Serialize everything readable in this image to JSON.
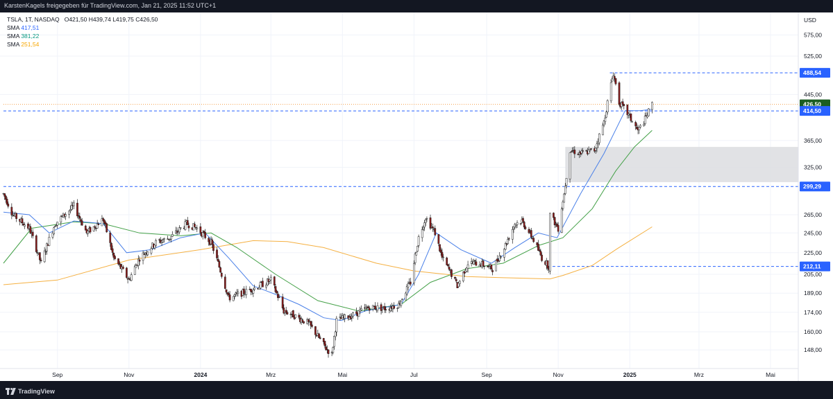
{
  "header": {
    "credit": "KarstenKagels freigegeben für TradingView.com, Jan 21, 2025 11:52 UTC+1"
  },
  "legend": {
    "symbol_line": "TSLA, 1T, NASDAQ",
    "ohlc": "O421,50  H439,74  L419,75  C426,50",
    "ma": [
      {
        "label": "SMA",
        "value": "417,51",
        "color": "#2962ff"
      },
      {
        "label": "SMA",
        "value": "381,22",
        "color": "#43a047"
      },
      {
        "label": "SMA",
        "value": "251,54",
        "color": "#f5b041"
      }
    ]
  },
  "footer": {
    "brand": "TradingView"
  },
  "chart_data": {
    "type": "candlestick",
    "currency_label": "USD",
    "y_scale": "log",
    "ylim": [
      140,
      620
    ],
    "y_ticks": [
      {
        "value": 575,
        "label": "575,00"
      },
      {
        "value": 525,
        "label": "525,00"
      },
      {
        "value": 445,
        "label": "445,00"
      },
      {
        "value": 365,
        "label": "365,00"
      },
      {
        "value": 325,
        "label": "325,00"
      },
      {
        "value": 265,
        "label": "265,00"
      },
      {
        "value": 245,
        "label": "245,00"
      },
      {
        "value": 225,
        "label": "225,00"
      },
      {
        "value": 205,
        "label": "205,00"
      },
      {
        "value": 189,
        "label": "189,00"
      },
      {
        "value": 174,
        "label": "174,00"
      },
      {
        "value": 160,
        "label": "160,00"
      },
      {
        "value": 148,
        "label": "148,00"
      }
    ],
    "x_ticks": [
      {
        "date": "2023-09-01",
        "label": "Sep",
        "bold": false
      },
      {
        "date": "2023-11-01",
        "label": "Nov",
        "bold": false
      },
      {
        "date": "2024-01-01",
        "label": "2024",
        "bold": true
      },
      {
        "date": "2024-03-01",
        "label": "Mrz",
        "bold": false
      },
      {
        "date": "2024-05-01",
        "label": "Mai",
        "bold": false
      },
      {
        "date": "2024-07-01",
        "label": "Jul",
        "bold": false
      },
      {
        "date": "2024-09-01",
        "label": "Sep",
        "bold": false
      },
      {
        "date": "2024-11-01",
        "label": "Nov",
        "bold": false
      },
      {
        "date": "2025-01-01",
        "label": "2025",
        "bold": true
      },
      {
        "date": "2025-03-01",
        "label": "Mrz",
        "bold": false
      },
      {
        "date": "2025-05-01",
        "label": "Mai",
        "bold": false
      }
    ],
    "price_path": [
      [
        "2023-07-17",
        290
      ],
      [
        "2023-07-25",
        265
      ],
      [
        "2023-08-08",
        250
      ],
      [
        "2023-08-18",
        215
      ],
      [
        "2023-08-30",
        255
      ],
      [
        "2023-09-15",
        275
      ],
      [
        "2023-09-26",
        245
      ],
      [
        "2023-10-10",
        260
      ],
      [
        "2023-10-19",
        220
      ],
      [
        "2023-11-01",
        200
      ],
      [
        "2023-11-10",
        220
      ],
      [
        "2023-11-24",
        235
      ],
      [
        "2023-12-06",
        240
      ],
      [
        "2023-12-20",
        255
      ],
      [
        "2023-12-29",
        250
      ],
      [
        "2024-01-10",
        235
      ],
      [
        "2024-01-25",
        185
      ],
      [
        "2024-02-08",
        190
      ],
      [
        "2024-02-20",
        195
      ],
      [
        "2024-03-01",
        200
      ],
      [
        "2024-03-12",
        175
      ],
      [
        "2024-03-20",
        172
      ],
      [
        "2024-04-02",
        166
      ],
      [
        "2024-04-17",
        149
      ],
      [
        "2024-04-22",
        145
      ],
      [
        "2024-04-26",
        168
      ],
      [
        "2024-05-10",
        172
      ],
      [
        "2024-05-24",
        178
      ],
      [
        "2024-06-07",
        177
      ],
      [
        "2024-06-18",
        180
      ],
      [
        "2024-06-28",
        198
      ],
      [
        "2024-07-05",
        240
      ],
      [
        "2024-07-11",
        262
      ],
      [
        "2024-07-19",
        245
      ],
      [
        "2024-07-25",
        220
      ],
      [
        "2024-08-02",
        205
      ],
      [
        "2024-08-07",
        195
      ],
      [
        "2024-08-16",
        215
      ],
      [
        "2024-08-26",
        215
      ],
      [
        "2024-09-06",
        210
      ],
      [
        "2024-09-16",
        230
      ],
      [
        "2024-09-25",
        255
      ],
      [
        "2024-10-01",
        258
      ],
      [
        "2024-10-10",
        240
      ],
      [
        "2024-10-18",
        220
      ],
      [
        "2024-10-24",
        212
      ],
      [
        "2024-10-25",
        265
      ],
      [
        "2024-11-01",
        250
      ],
      [
        "2024-11-06",
        290
      ],
      [
        "2024-11-11",
        350
      ],
      [
        "2024-11-20",
        345
      ],
      [
        "2024-12-02",
        350
      ],
      [
        "2024-12-10",
        395
      ],
      [
        "2024-12-18",
        488
      ],
      [
        "2024-12-23",
        430
      ],
      [
        "2024-12-30",
        410
      ],
      [
        "2025-01-08",
        380
      ],
      [
        "2025-01-14",
        400
      ],
      [
        "2025-01-20",
        426.5
      ]
    ],
    "sma_short_path": [
      [
        "2023-07-17",
        268
      ],
      [
        "2023-08-08",
        265
      ],
      [
        "2023-08-25",
        245
      ],
      [
        "2023-09-15",
        258
      ],
      [
        "2023-10-10",
        255
      ],
      [
        "2023-10-30",
        225
      ],
      [
        "2023-11-20",
        228
      ],
      [
        "2023-12-15",
        240
      ],
      [
        "2024-01-05",
        245
      ],
      [
        "2024-01-25",
        220
      ],
      [
        "2024-02-15",
        195
      ],
      [
        "2024-03-05",
        188
      ],
      [
        "2024-03-25",
        180
      ],
      [
        "2024-04-15",
        170
      ],
      [
        "2024-04-30",
        168
      ],
      [
        "2024-05-20",
        175
      ],
      [
        "2024-06-20",
        180
      ],
      [
        "2024-07-05",
        205
      ],
      [
        "2024-07-20",
        245
      ],
      [
        "2024-08-10",
        228
      ],
      [
        "2024-09-05",
        215
      ],
      [
        "2024-09-25",
        230
      ],
      [
        "2024-10-15",
        245
      ],
      [
        "2024-10-31",
        240
      ],
      [
        "2024-11-20",
        290
      ],
      [
        "2024-12-10",
        345
      ],
      [
        "2024-12-28",
        415
      ],
      [
        "2025-01-10",
        415
      ],
      [
        "2025-01-20",
        417.51
      ]
    ],
    "sma_mid_path": [
      [
        "2023-07-17",
        215
      ],
      [
        "2023-08-10",
        250
      ],
      [
        "2023-09-15",
        257
      ],
      [
        "2023-10-10",
        255
      ],
      [
        "2023-11-10",
        245
      ],
      [
        "2023-12-15",
        242
      ],
      [
        "2024-01-10",
        245
      ],
      [
        "2024-02-01",
        230
      ],
      [
        "2024-03-05",
        205
      ],
      [
        "2024-04-10",
        183
      ],
      [
        "2024-05-15",
        175
      ],
      [
        "2024-06-20",
        180
      ],
      [
        "2024-07-15",
        198
      ],
      [
        "2024-08-15",
        210
      ],
      [
        "2024-09-15",
        215
      ],
      [
        "2024-10-15",
        232
      ],
      [
        "2024-11-05",
        240
      ],
      [
        "2024-11-30",
        272
      ],
      [
        "2024-12-20",
        320
      ],
      [
        "2025-01-05",
        355
      ],
      [
        "2025-01-20",
        381.22
      ]
    ],
    "sma_long_path": [
      [
        "2023-07-17",
        196
      ],
      [
        "2023-09-01",
        200
      ],
      [
        "2023-11-01",
        218
      ],
      [
        "2024-01-01",
        228
      ],
      [
        "2024-02-15",
        237
      ],
      [
        "2024-03-15",
        236
      ],
      [
        "2024-04-15",
        230
      ],
      [
        "2024-05-30",
        215
      ],
      [
        "2024-07-01",
        208
      ],
      [
        "2024-08-15",
        203
      ],
      [
        "2024-09-15",
        202
      ],
      [
        "2024-10-25",
        201
      ],
      [
        "2024-11-05",
        204
      ],
      [
        "2024-11-30",
        213
      ],
      [
        "2024-12-20",
        228
      ],
      [
        "2025-01-20",
        251.54
      ]
    ],
    "horizontal_levels": [
      {
        "value": 488.54,
        "label": "488,54",
        "style": "dashed",
        "color": "#2962ff",
        "from": "2024-12-15"
      },
      {
        "value": 426.5,
        "label": "426,50",
        "style": "dotted",
        "color": "#f5a04a",
        "from": "2023-07-17",
        "badge_color": "#1b5e20"
      },
      {
        "value": 414.5,
        "label": "414,50",
        "style": "dashed",
        "color": "#2962ff",
        "from": "2023-07-17"
      },
      {
        "value": 299.29,
        "label": "299,29",
        "style": "dashed",
        "color": "#2962ff",
        "from": "2023-07-17"
      },
      {
        "value": 212.11,
        "label": "212,11",
        "style": "dashed",
        "color": "#2962ff",
        "from": "2024-10-23"
      }
    ],
    "gap_zone": {
      "from": "2024-11-07",
      "y_low": 305,
      "y_high": 355,
      "color": "#dcdde0"
    },
    "candle_up_color": "#089981",
    "candle_down_color": "#f23645"
  }
}
